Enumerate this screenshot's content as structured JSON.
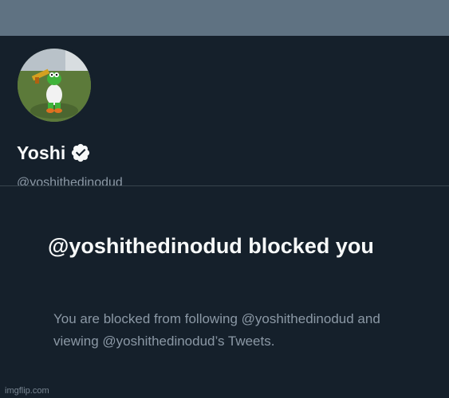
{
  "profile": {
    "display_name": "Yoshi",
    "handle": "@yoshithedinodud",
    "verified_icon": "verified-badge-icon",
    "avatar_icon": "yoshi-avatar"
  },
  "blocked": {
    "title": "@yoshithedinodud blocked you",
    "subtitle": "You are blocked from following @yoshithedinodud and viewing @yoshithedinodud’s Tweets."
  },
  "watermark": "imgflip.com",
  "colors": {
    "background": "#15202b",
    "banner": "#5f7282",
    "text_primary": "#f7f9f9",
    "text_secondary": "#8b98a5"
  }
}
